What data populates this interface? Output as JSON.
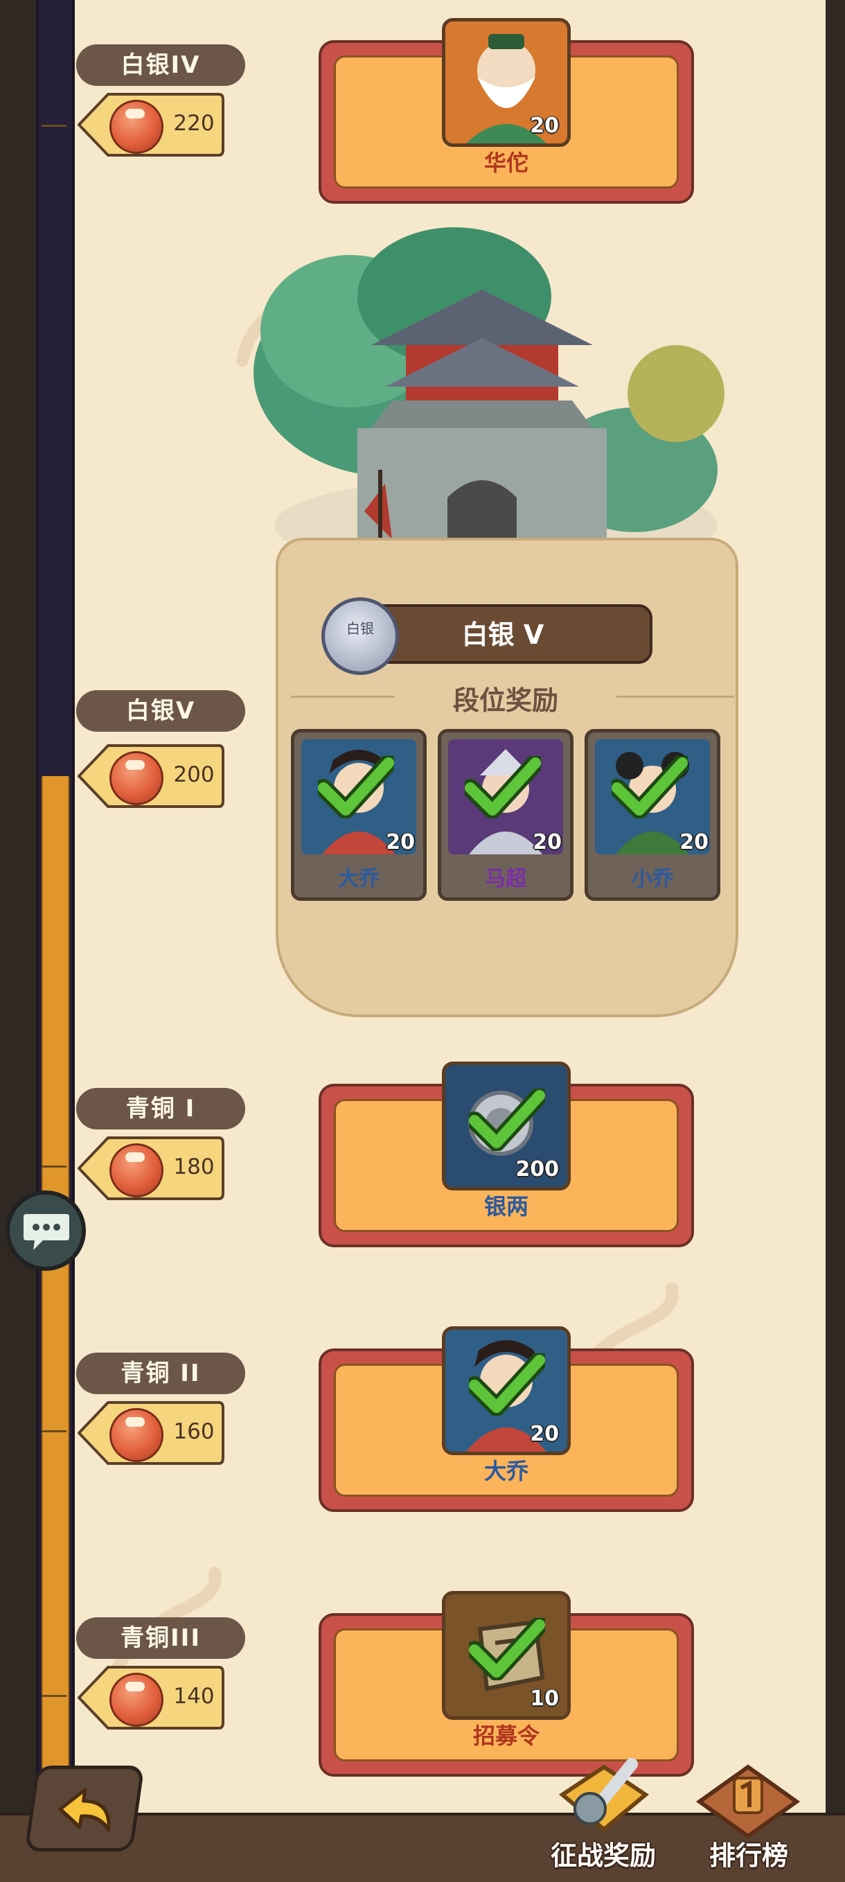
{
  "milestones": [
    {
      "tier": "白银IV",
      "points": "220",
      "reward_name": "华佗",
      "reward_qty": "20"
    },
    {
      "tier": "白银V",
      "points": "200"
    },
    {
      "tier": "青铜 I",
      "points": "180",
      "reward_name": "银两",
      "reward_qty": "200"
    },
    {
      "tier": "青铜 II",
      "points": "160",
      "reward_name": "大乔",
      "reward_qty": "20"
    },
    {
      "tier": "青铜III",
      "points": "140",
      "reward_name": "招募令",
      "reward_qty": "10"
    }
  ],
  "current_rank": {
    "emblem_text": "白银",
    "title": "白银 V",
    "rewards_heading": "段位奖励",
    "heroes": [
      {
        "name": "大乔",
        "qty": "20",
        "claimed": true
      },
      {
        "name": "马超",
        "qty": "20",
        "claimed": true
      },
      {
        "name": "小乔",
        "qty": "20",
        "claimed": true
      }
    ]
  },
  "nav": {
    "campaign_rewards": "征战奖励",
    "leaderboard": "排行榜"
  },
  "colors": {
    "card_frame": "#c9514a",
    "card_fill": "#fbb45a",
    "progress_fill": "#e0962a",
    "hero_name_blue": "#2b5aa0",
    "hero_name_purple": "#7a2ea8",
    "check_green": "#5ec43a"
  },
  "icons": [
    "back-arrow-icon",
    "chat-icon",
    "coin-pot-icon",
    "check-icon",
    "silver-rank-emblem-icon",
    "sword-shield-icon",
    "trophy-icon"
  ]
}
